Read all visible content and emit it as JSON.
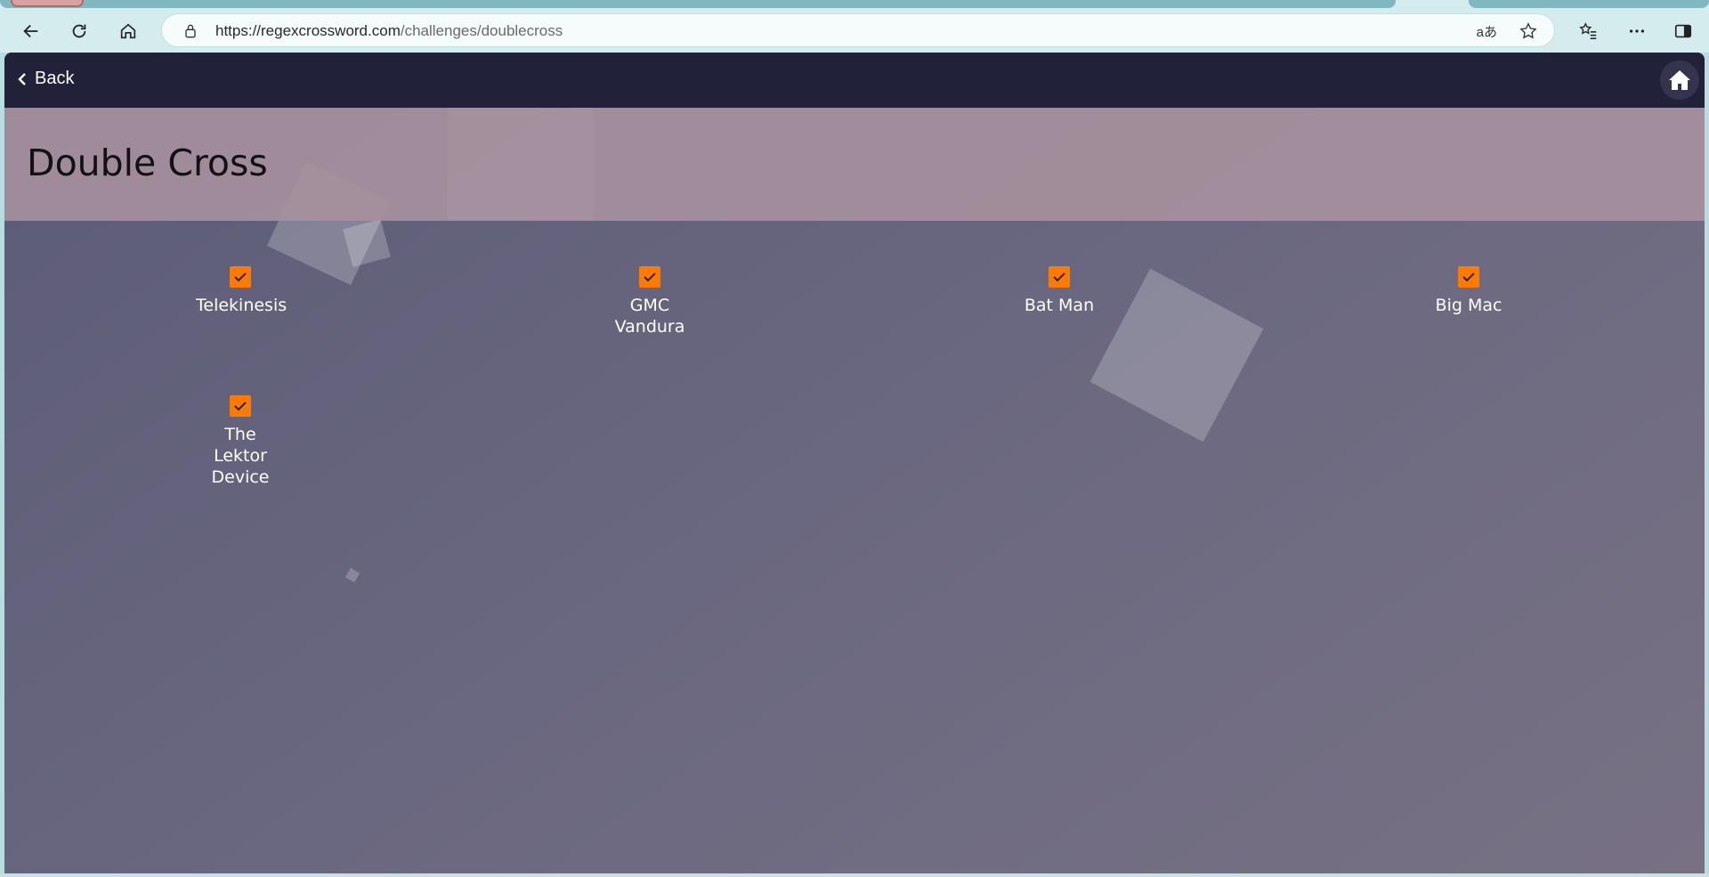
{
  "browser": {
    "url_domain": "https://regexcrossword.com",
    "url_path": "/challenges/doublecross",
    "read_aloud_glyph": "aあ"
  },
  "nav": {
    "back_label": "Back"
  },
  "page": {
    "title": "Double Cross"
  },
  "challenges": [
    {
      "label": "Telekinesis",
      "completed": true
    },
    {
      "label": "GMC Vandura",
      "completed": true
    },
    {
      "label": "Bat Man",
      "completed": true
    },
    {
      "label": "Big Mac",
      "completed": true
    },
    {
      "label": "The Lektor Device",
      "completed": true
    }
  ],
  "colors": {
    "nav_bg": "#21213a",
    "accent_check": "#ff7a00",
    "title_band": "#a8929e"
  }
}
